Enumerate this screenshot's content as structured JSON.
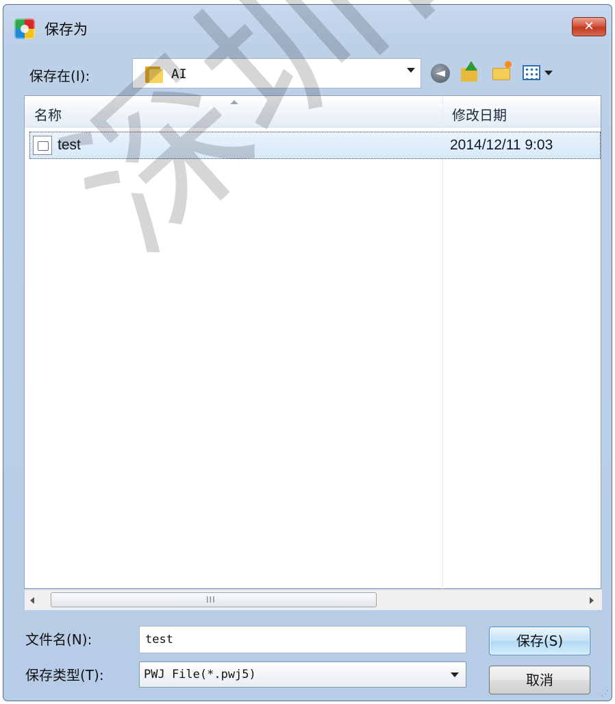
{
  "window": {
    "title": "保存为",
    "close_label": "✕"
  },
  "toolbar": {
    "save_in_label": "保存在(I):",
    "location_value": "AI",
    "back_icon": "back-arrow-icon",
    "up_icon": "up-folder-icon",
    "new_folder_icon": "new-folder-icon",
    "views_icon": "view-menu-icon"
  },
  "file_list": {
    "columns": [
      "名称",
      "修改日期"
    ],
    "rows": [
      {
        "name": "test",
        "modified": "2014/12/11 9:03"
      }
    ],
    "scroll_grip": "III"
  },
  "form": {
    "filename_label": "文件名(N):",
    "filename_value": "test",
    "filetype_label": "保存类型(T):",
    "filetype_value": "PWJ File(*.pwj5)",
    "save_button": "保存(S)",
    "cancel_button": "取消"
  },
  "watermark": {
    "text": "深圳吉顺"
  },
  "colors": {
    "window_frame": "#b7cce6",
    "selection": "#d7e9fb",
    "primary_button_border": "#3b8fd6",
    "close_button": "#c23a22"
  }
}
